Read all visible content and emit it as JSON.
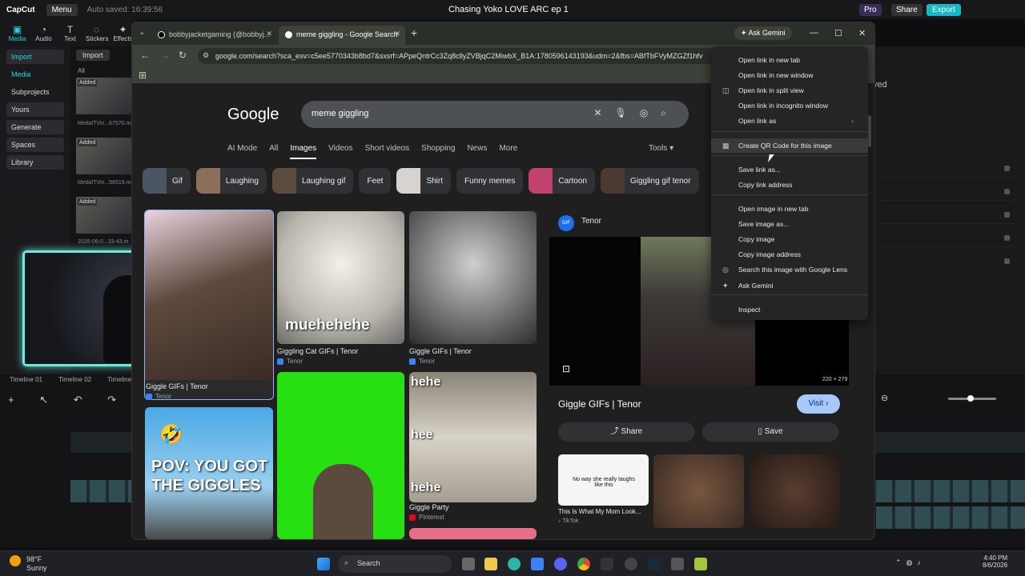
{
  "capcut": {
    "logo": "CapCut",
    "menu": "Menu",
    "autosave": "Auto saved: 16:39:56",
    "project_title": "Chasing Yoko LOVE ARC ep 1",
    "pro": "Pro",
    "share": "Share",
    "export": "Export",
    "tools": [
      "Media",
      "Audio",
      "Text",
      "Stickers",
      "Effects"
    ],
    "sidebar": [
      "Import",
      "Media",
      "Subprojects",
      "Yours",
      "Generate",
      "Spaces",
      "Library"
    ],
    "import_btn": "Import",
    "all_label": "All",
    "added_tag": "Added",
    "thumb_names": [
      "MedalTVin...67570.mp",
      "MedalTVin...56519.mp",
      "2026-06-0...33-43.m"
    ],
    "timeline_tabs": [
      "Timeline 01",
      "Timeline 02",
      "Timeline"
    ],
    "right_text": "ved"
  },
  "chrome": {
    "tabs": [
      {
        "label": "bobbyjacketgaming (@bobbyj...",
        "active": false
      },
      {
        "label": "meme giggling - Google Search",
        "active": true
      }
    ],
    "ask_gemini": "Ask Gemini",
    "url": "google.com/search?sca_esv=c5ee5770343b8bd7&sxsrf=APpeQntrCc3Zq8cllyZVBjqC2MiwbX_B1A:1780596143193&udm=2&fbs=ABfTbFVyMZGZf1hfv"
  },
  "google": {
    "logo": "Google",
    "query": "meme giggling",
    "nav": [
      "AI Mode",
      "All",
      "Images",
      "Videos",
      "Short videos",
      "Shopping",
      "News",
      "More"
    ],
    "nav_active": "Images",
    "tools": "Tools",
    "chips": [
      {
        "label": "Gif",
        "img": true,
        "color": "#4b5563"
      },
      {
        "label": "Laughing",
        "img": true,
        "color": "#8b6f5a"
      },
      {
        "label": "Laughing gif",
        "img": true,
        "color": "#5c4b3f"
      },
      {
        "label": "Feet",
        "img": false
      },
      {
        "label": "Shirt",
        "img": true,
        "color": "#d6d3d1"
      },
      {
        "label": "Funny memes",
        "img": false
      },
      {
        "label": "Cartoon",
        "img": true,
        "color": "#c2416d"
      },
      {
        "label": "Giggling gif tenor",
        "img": true,
        "color": "#4a3a32"
      }
    ],
    "results": [
      {
        "title": "Giggle GIFs | Tenor",
        "source": "Tenor"
      },
      {
        "title": "Giggling Cat GIFs | Tenor",
        "source": "Tenor",
        "overlay": "muehehehe"
      },
      {
        "title": "Giggle GIFs | Tenor",
        "source": "Tenor"
      },
      {
        "title": "",
        "source": "",
        "overlay": "POV: YOU GOT THE GIGGLES"
      },
      {
        "title": "",
        "source": ""
      },
      {
        "title": "Giggle Party",
        "source": "Pinterest",
        "overlay": [
          "hehe",
          "hee",
          "hehe"
        ]
      }
    ],
    "preview": {
      "source": "Tenor",
      "fav_text": "GIF",
      "dimensions": "220 × 279",
      "title": "Giggle GIFs | Tenor",
      "visit": "Visit",
      "share": "Share",
      "save": "Save",
      "related": [
        {
          "title": "This Is What My Mom Look...",
          "source": "TikTok",
          "caption": "No way she really laughs like this"
        }
      ]
    }
  },
  "context_menu": [
    {
      "label": "Open link in new tab",
      "icon": "",
      "arrow": false
    },
    {
      "label": "Open link in new window",
      "icon": "",
      "arrow": false
    },
    {
      "label": "Open link in split view",
      "icon": "split-view-icon",
      "arrow": false
    },
    {
      "label": "Open link in incognito window",
      "icon": "",
      "arrow": false
    },
    {
      "label": "Open link as",
      "icon": "",
      "arrow": true
    },
    {
      "label": "Create QR Code for this image",
      "icon": "qr-icon",
      "arrow": false
    },
    {
      "label": "Save link as...",
      "icon": "",
      "arrow": false
    },
    {
      "label": "Copy link address",
      "icon": "",
      "arrow": false
    },
    {
      "label": "Open image in new tab",
      "icon": "",
      "arrow": false
    },
    {
      "label": "Save image as...",
      "icon": "",
      "arrow": false
    },
    {
      "label": "Copy image",
      "icon": "",
      "arrow": false
    },
    {
      "label": "Copy image address",
      "icon": "",
      "arrow": false
    },
    {
      "label": "Search this image with Google Lens",
      "icon": "lens-icon",
      "arrow": false
    },
    {
      "label": "Ask Gemini",
      "icon": "gemini-icon",
      "arrow": false
    },
    {
      "label": "Inspect",
      "icon": "",
      "arrow": false
    }
  ],
  "taskbar": {
    "temp": "98°F",
    "condition": "Sunny",
    "search": "Search",
    "time": "4:40 PM",
    "date": "8/6/2026"
  }
}
